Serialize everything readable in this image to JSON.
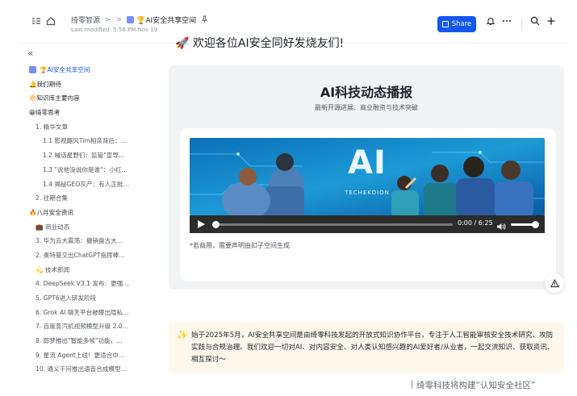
{
  "header": {
    "breadcrumb_root": "绮零智源",
    "breadcrumb_sep": ">",
    "breadcrumb_current": "🏆AI安全共享空间",
    "last_modified": "Last modified: 5:58 PM Nov 19",
    "share_label": "Share",
    "icons": [
      "outline-icon",
      "home-icon",
      "pin-icon",
      "bell-icon",
      "more-icon",
      "search-icon",
      "add-icon"
    ]
  },
  "sidebar": {
    "collapse_glyph": "«",
    "items": [
      {
        "label": "🏆AI安全共享空间",
        "level": 0,
        "active": true
      },
      {
        "label": "🔔我们期待",
        "level": 0
      },
      {
        "label": "🔆知识库主要内容",
        "level": 0
      },
      {
        "label": "😁绮零思考",
        "level": 0
      },
      {
        "label": "1. 精华文章",
        "level": 1
      },
      {
        "label": "1.1 影视飓风Tim相亲背后：…",
        "level": 2
      },
      {
        "label": "1.2 喊话星野们：监管\"宣导…",
        "level": 2
      },
      {
        "label": "1.3 \"说他没说你是谁\"：小红…",
        "level": 2
      },
      {
        "label": "1.4 揭秘GEO灰产：有人正批…",
        "level": 2
      },
      {
        "label": "2. 往期合集",
        "level": 1
      },
      {
        "label": "🔥八月安全资讯",
        "level": 0
      },
      {
        "label": "💼 商业动态",
        "level": 1
      },
      {
        "label": "3. 华为云大震荡：撤销盘古大…",
        "level": 1
      },
      {
        "label": "2. 奥特曼交出ChatGPT指挥棒…",
        "level": 1
      },
      {
        "label": "💫 技术新闻",
        "level": 1
      },
      {
        "label": "4. DeepSeek V3.1 发布：更强…",
        "level": 1
      },
      {
        "label": "5. GPT6进入研发阶段",
        "level": 1
      },
      {
        "label": "6. Grok AI 聊天平台被曝出隐私…",
        "level": 1
      },
      {
        "label": "7. 百度蒸汽机视频模型升级 2.0…",
        "level": 1
      },
      {
        "label": "8. 即梦推出\"智能多帧\"功能，…",
        "level": 1
      },
      {
        "label": "9. 星流 Agent上线！更适合中…",
        "level": 1
      },
      {
        "label": "10. 通义千问推出语音合成模型…",
        "level": 1
      }
    ]
  },
  "main": {
    "heading": "🚀 欢迎各位AI安全同好发烧友们!",
    "card_title": "AI科技动态播报",
    "card_subtitle": "最新开源进展、商业融资与技术突破",
    "video": {
      "banner_big": "AI",
      "banner_small": "TECHEKOION",
      "time": "0:00 / 6:25",
      "progress": 0.0,
      "volume": 1.0
    },
    "caption": "*若商用，需要声明由扣子空间生成",
    "callout_icon": "sparkle-icon",
    "callout_text": "始于2025年5月，AI安全共享空间是由绮零科技发起的开放式知识协作平台，专注于人工智能审核安全技术研究、攻防实践与合规治理。我们欢迎一切对AI、对内容安全、对人类认知感兴趣的AI爱好者/从业者，一起交流知识、获取资讯、相互探讨～"
  },
  "footer_caption": "绮零科技将构建“认知安全社区”",
  "colors": {
    "accent": "#1456f0",
    "callout_bg": "#fef8ec",
    "card_bg": "#f2f3f5"
  }
}
